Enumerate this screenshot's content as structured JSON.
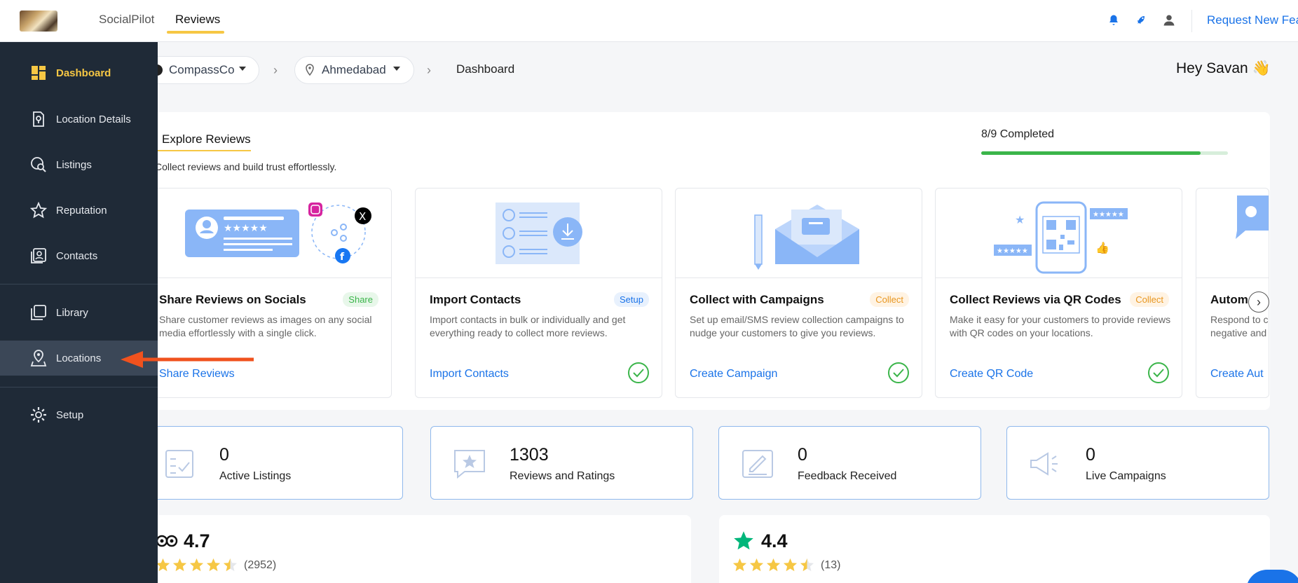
{
  "topbar": {
    "tabs": [
      {
        "label": "SocialPilot"
      },
      {
        "label": "Reviews"
      }
    ],
    "request_link": "Request New Feat"
  },
  "sidebar": {
    "items": [
      {
        "label": "Dashboard",
        "icon": "dashboard-icon"
      },
      {
        "label": "Location Details",
        "icon": "location-details-icon"
      },
      {
        "label": "Listings",
        "icon": "listings-icon"
      },
      {
        "label": "Reputation",
        "icon": "star-icon"
      },
      {
        "label": "Contacts",
        "icon": "contacts-icon"
      },
      {
        "label": "Library",
        "icon": "library-icon"
      },
      {
        "label": "Locations",
        "icon": "locations-icon"
      },
      {
        "label": "Setup",
        "icon": "gear-icon"
      }
    ]
  },
  "header": {
    "brand": "CompassCo",
    "location": "Ahmedabad",
    "page": "Dashboard",
    "greeting": "Hey Savan 👋"
  },
  "explore": {
    "title": "Explore Reviews",
    "subtitle": "Collect reviews and build trust effortlessly.",
    "progress_text": "8/9 Completed",
    "progress_fraction": 0.889,
    "cards": [
      {
        "title": "Share Reviews on Socials",
        "badge": "Share",
        "desc": "Share customer reviews as images on any social media effortlessly with a single click.",
        "link": "Share Reviews"
      },
      {
        "title": "Import Contacts",
        "badge": "Setup",
        "desc": "Import contacts in bulk or individually and get everything ready to collect more reviews.",
        "link": "Import Contacts"
      },
      {
        "title": "Collect with Campaigns",
        "badge": "Collect",
        "desc": "Set up email/SMS review collection campaigns to nudge your customers to give you reviews.",
        "link": "Create Campaign"
      },
      {
        "title": "Collect Reviews via QR Codes",
        "badge": "Collect",
        "desc": "Make it easy for your customers to provide reviews with QR codes on your locations.",
        "link": "Create QR Code"
      },
      {
        "title": "Automa",
        "desc": "Respond to c negative and",
        "link": "Create Aut"
      }
    ]
  },
  "stats": [
    {
      "value": "0",
      "label": "Active Listings"
    },
    {
      "value": "1303",
      "label": "Reviews and Ratings"
    },
    {
      "value": "0",
      "label": "Feedback Received"
    },
    {
      "value": "0",
      "label": "Live Campaigns"
    }
  ],
  "ratings": [
    {
      "score": "4.7",
      "count": "(2952)",
      "stars": 4.5,
      "source_icon": "tripadvisor-icon"
    },
    {
      "score": "4.4",
      "count": "(13)",
      "stars": 4.5,
      "source_icon": "trustpilot-star-icon"
    }
  ],
  "colors": {
    "accent": "#f6c744",
    "sidebar": "#1f2a37",
    "link": "#1a73e8",
    "success": "#3bb54a",
    "arrow": "#f0521e"
  }
}
